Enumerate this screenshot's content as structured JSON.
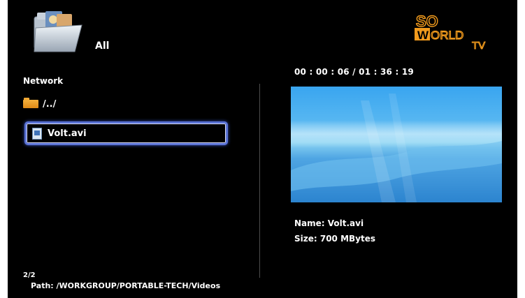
{
  "header": {
    "section_title": "All",
    "logo": {
      "line1": "SO",
      "line2": "WORLD",
      "line3": "TV",
      "color_primary": "#f29b1d",
      "color_box": "#f29b1d"
    }
  },
  "browser": {
    "source_label": "Network",
    "items": [
      {
        "label": "/../",
        "icon": "folder-icon"
      },
      {
        "label": "Volt.avi",
        "icon": "video-file-icon",
        "selected": true
      }
    ],
    "page_count": "2/2",
    "path": "Path: /WORKGROUP/PORTABLE-TECH/Videos",
    "selection_color": "#5b73d6"
  },
  "preview": {
    "time": "00 : 00 : 06 / 01 : 36 : 19",
    "name": "Name: Volt.avi",
    "size": "Size: 700 MBytes"
  }
}
